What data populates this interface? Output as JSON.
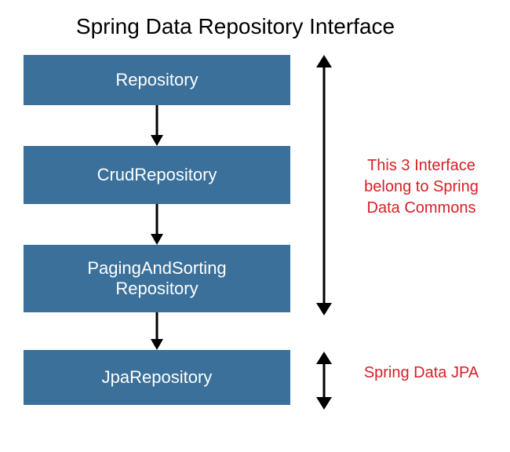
{
  "title": "Spring Data Repository Interface",
  "boxes": [
    {
      "label": "Repository"
    },
    {
      "label": "CrudRepository"
    },
    {
      "label_line1": "PagingAndSorting",
      "label_line2": "Repository"
    },
    {
      "label": "JpaRepository"
    }
  ],
  "annotations": [
    {
      "text": "This 3 Interface belong to Spring Data Commons"
    },
    {
      "text": "Spring Data JPA"
    }
  ],
  "colors": {
    "box_bg": "#3a709a",
    "box_text": "#ffffff",
    "annotation_text": "#d62027",
    "title_text": "#000000",
    "arrow": "#000000"
  }
}
